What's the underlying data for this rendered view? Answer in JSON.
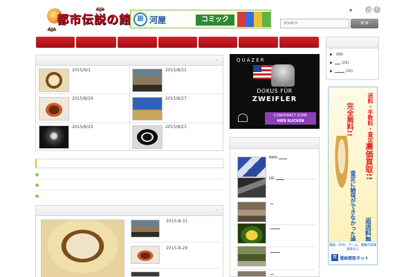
{
  "header": {
    "site_title": "都市伝説の館",
    "banner": {
      "circle_label": "銀",
      "name": "河屋",
      "comic_label": "コミック"
    },
    "top_dot": "●",
    "search": {
      "placeholder": "SEARCH",
      "button_label": "検 索"
    }
  },
  "nav": {
    "item_count": 7
  },
  "latest": {
    "arrow": "»",
    "items": [
      {
        "date": "2015/9/1"
      },
      {
        "date": "2015/8/31"
      },
      {
        "date": "2015/8/29"
      },
      {
        "date": "2015/8/27"
      },
      {
        "date": "2015/8/25"
      },
      {
        "date": "2015/8/23"
      }
    ]
  },
  "notice": {
    "bullets": [
      "●",
      "●",
      "● ..."
    ]
  },
  "featured": {
    "arrow": "»",
    "items": [
      {
        "date": "2015-8-31"
      },
      {
        "date": "2015-8-29"
      }
    ]
  },
  "ad_quazer": {
    "brand": "QUAZER",
    "line1": "DOKUS FÜR",
    "line2": "ZWEIFLER",
    "button_line1": "CONSPIRACY ZONE",
    "button_line2": "HIER KLICKEN",
    "cta_arrow": "▶"
  },
  "categories": {
    "items": [
      {
        "count": "(69)"
      },
      {
        "count": "(23)"
      },
      {
        "count": "(20)"
      }
    ]
  },
  "popular": {
    "items": [
      {
        "text": "BWN"
      },
      {
        "text": "DD"
      },
      {
        "text": ""
      },
      {
        "text": ""
      },
      {
        "text": ""
      },
      {
        "text": ""
      }
    ]
  },
  "ad_tall": {
    "line_shipping": "送料・手数料・査定料",
    "line_free": "完全無料!!",
    "line_buy": "高価買取!!",
    "line_return": "査定に納得ができなかった場合",
    "line_return_free": "返送料無料!!",
    "footer_text": "漫画、DVD、ゲーム、書籍の高価買取なら",
    "footer_mark": "買",
    "footer_name": "漫画買取ネット"
  },
  "colors": {
    "nav_red": "#c8151f",
    "accent_green": "#8cbf32",
    "accent_yellow": "#e7c400",
    "ad_purple": "#8d3fb8"
  },
  "icons": [
    "rss-icon",
    "twitter-icon",
    "bat-icon",
    "moon-icon",
    "arrow-icon"
  ]
}
